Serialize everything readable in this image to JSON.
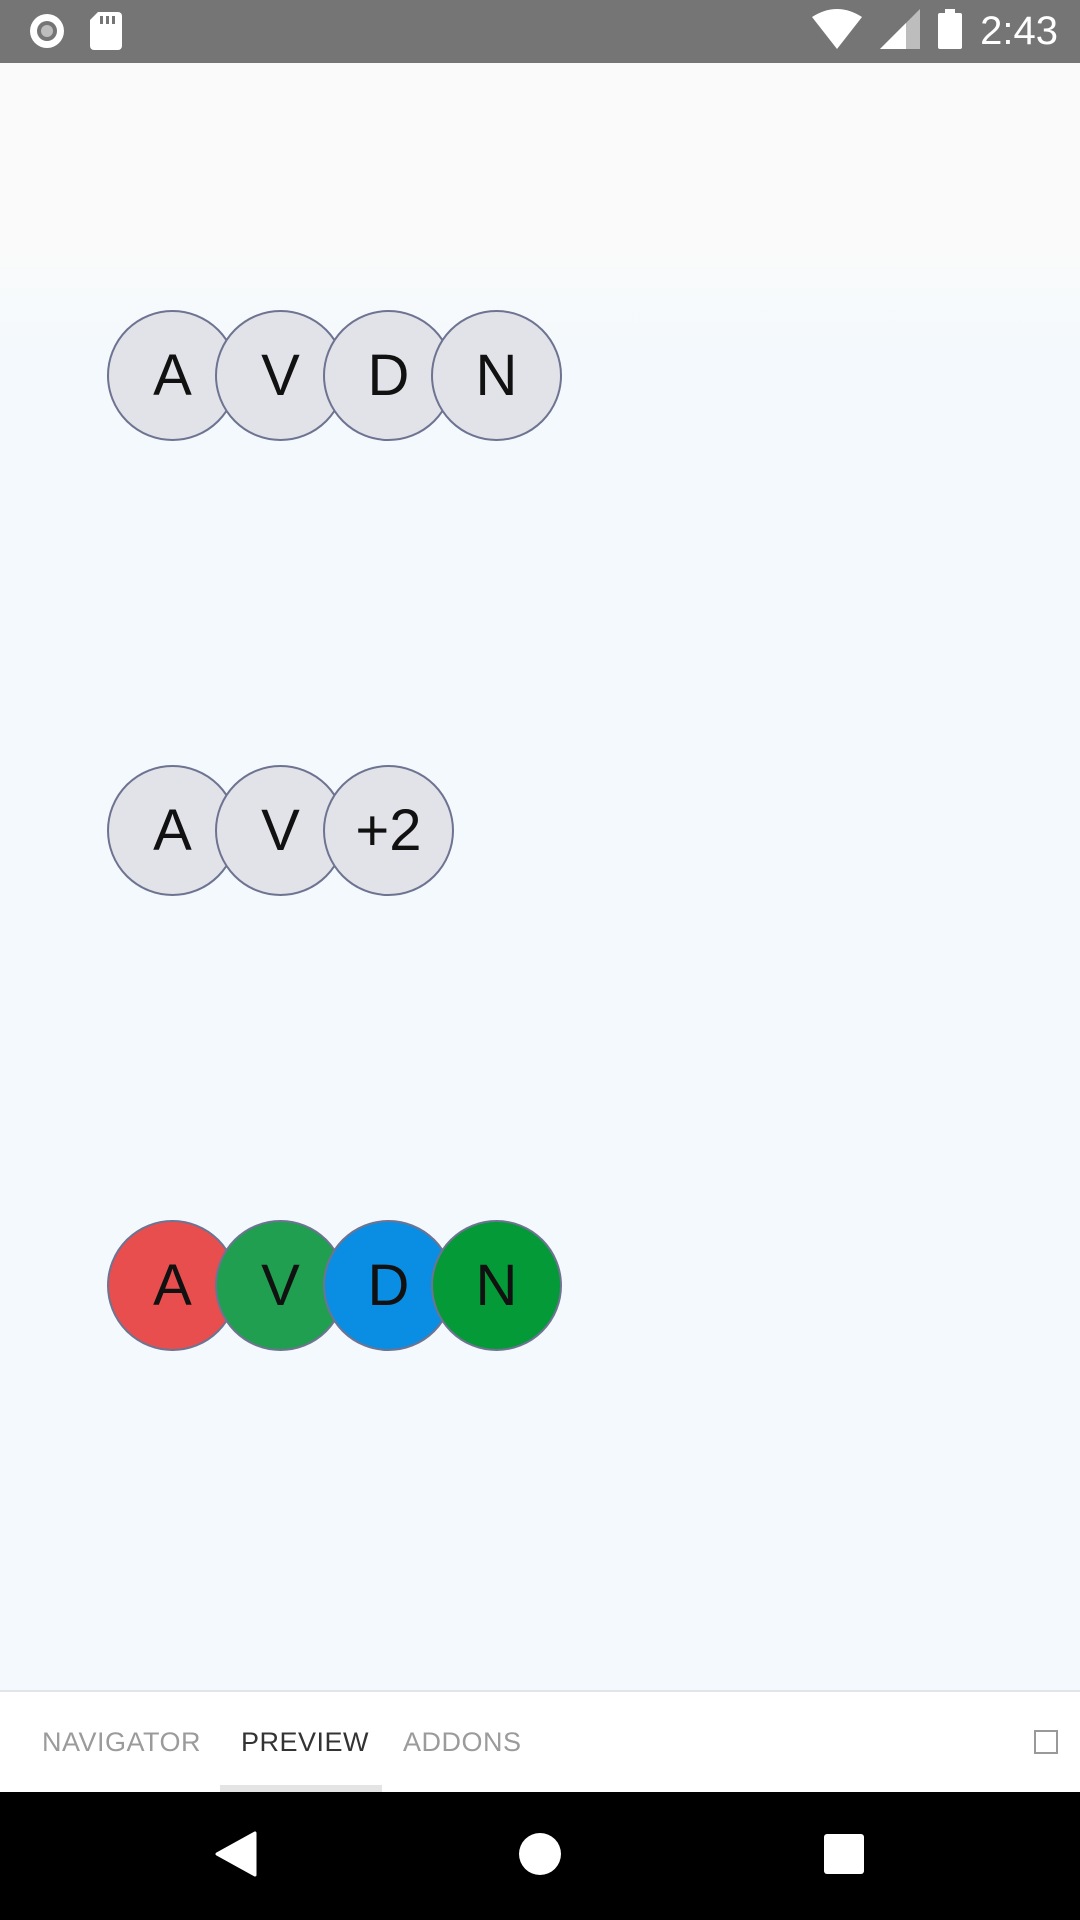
{
  "status_bar": {
    "time": "2:43",
    "icons": [
      "record-icon",
      "sd-card-icon",
      "wifi-icon",
      "cell-signal-icon",
      "battery-icon"
    ]
  },
  "avatar_groups": [
    {
      "avatars": [
        {
          "label": "A"
        },
        {
          "label": "V"
        },
        {
          "label": "D"
        },
        {
          "label": "N"
        }
      ]
    },
    {
      "avatars": [
        {
          "label": "A"
        },
        {
          "label": "V"
        },
        {
          "label": "+2"
        }
      ]
    },
    {
      "avatars": [
        {
          "label": "A",
          "color": "#e94e4e"
        },
        {
          "label": "V",
          "color": "#1f9f4f"
        },
        {
          "label": "D",
          "color": "#0a8ee3"
        },
        {
          "label": "N",
          "color": "#039a37"
        }
      ]
    }
  ],
  "tabs": [
    {
      "label": "NAVIGATOR",
      "active": false
    },
    {
      "label": "PREVIEW",
      "active": true
    },
    {
      "label": "ADDONS",
      "active": false
    }
  ],
  "nav": [
    "back-icon",
    "home-icon",
    "recents-icon"
  ]
}
